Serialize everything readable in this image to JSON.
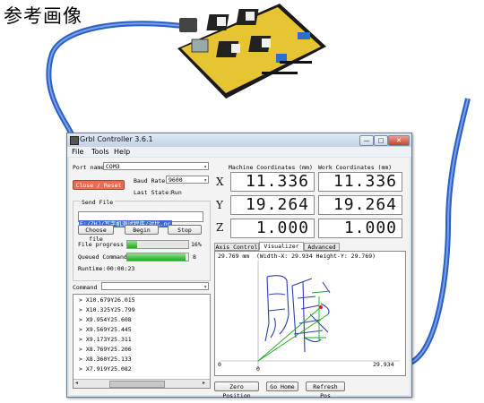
{
  "caption": "参考画像",
  "window": {
    "title": "Grbl Controller 3.6.1",
    "controls": {
      "minimize": "—",
      "maximize": "□",
      "close": "✕"
    }
  },
  "menu": {
    "file": "File",
    "tools": "Tools",
    "help": "Help"
  },
  "port": {
    "label": "Port name",
    "value": "COM3"
  },
  "baud": {
    "label": "Baud Rate",
    "value": "9600"
  },
  "close_reset": "Close / Reset",
  "last_state": {
    "label": "Last State:",
    "value": "Run"
  },
  "send_file": {
    "legend": "Send File",
    "path": "E:/ZHJ/写字机测试程序/对比.nc",
    "choose": "Choose file",
    "begin": "Begin",
    "stop": "Stop"
  },
  "progress": {
    "file_label": "File progress",
    "file_value": "16%",
    "file_fraction": 0.16,
    "queued_label": "Queued Commands",
    "queued_value": "8",
    "queued_fraction": 0.95,
    "runtime_label": "Runtime:",
    "runtime_value": "00:00:23"
  },
  "command": {
    "label": "Command",
    "value": ""
  },
  "console_lines": [
    "> X10.679Y26.015",
    "> X10.325Y25.799",
    "> X9.954Y25.608",
    "> X9.569Y25.445",
    "> X9.173Y25.311",
    "> X8.769Y25.206",
    "> X8.360Y25.133",
    "> X7.919Y25.082"
  ],
  "machine_coords": {
    "header": "Machine Coordinates (mm)",
    "x": "11.336",
    "y": "19.264",
    "z": "1.000"
  },
  "work_coords": {
    "header": "Work Coordinates (mm)",
    "x": "11.336",
    "y": "19.264",
    "z": "1.000"
  },
  "axis_labels": {
    "x": "X",
    "y": "Y",
    "z": "Z"
  },
  "tabs": [
    "Axis Control",
    "Visualizer",
    "Advanced"
  ],
  "visualizer": {
    "header_left": "29.769 mm",
    "header_dims": "(Width-X: 29.934  Height-Y: 29.769)",
    "corner_left": "0",
    "corner_bottom": "0",
    "corner_right": "29.934",
    "path_color": "#2a3fb0",
    "guide_color": "#1ea81e",
    "tool_color": "#e02020"
  },
  "bottom_buttons": {
    "zero": "Zero Position",
    "home": "Go Home",
    "refresh": "Refresh Pos"
  }
}
